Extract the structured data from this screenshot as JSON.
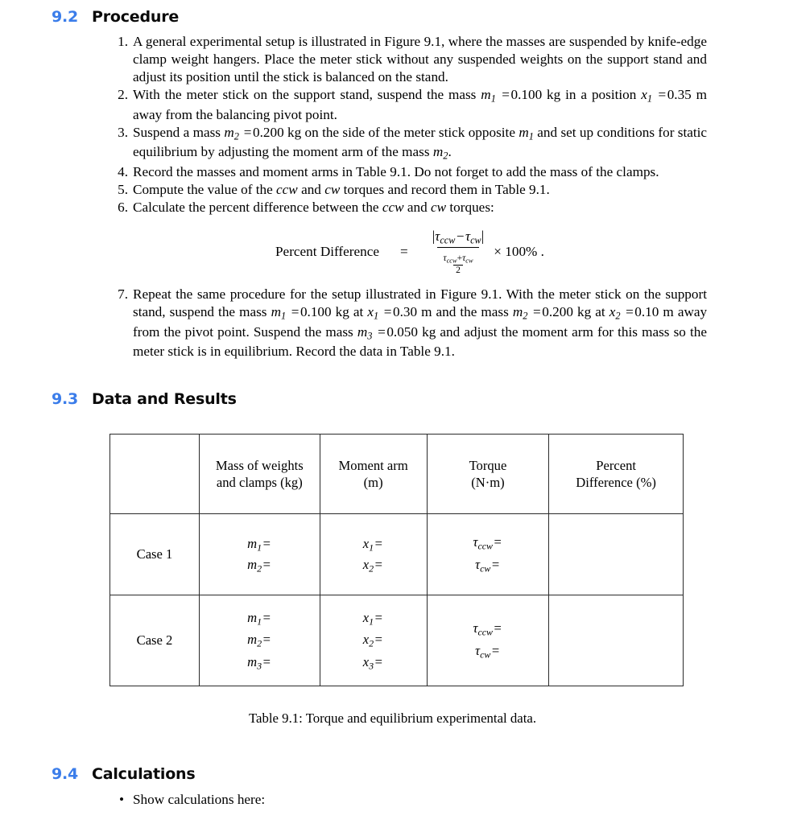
{
  "sections": {
    "procedure": {
      "num": "9.2",
      "title": "Procedure"
    },
    "data_results": {
      "num": "9.3",
      "title": "Data and Results"
    },
    "calculations": {
      "num": "9.4",
      "title": "Calculations"
    }
  },
  "procedure_steps": {
    "s1_marker": "1.",
    "s1_text": "A general experimental setup is illustrated in Figure 9.1, where the masses are suspended by knife-edge clamp weight hangers. Place the meter stick without any suspended weights on the support stand and adjust its position until the stick is balanced on the stand.",
    "s2_marker": "2.",
    "s2_a": "With the meter stick on the support stand, suspend the mass",
    "s2_m1": "m",
    "s2_m1_sub": "1",
    "s2_eq1": "=",
    "s2_val1": "0.100 kg in a position",
    "s2_x1": "x",
    "s2_x1_sub": "1",
    "s2_eq2": "=",
    "s2_val2": "0.35 m away from the balancing pivot point.",
    "s3_marker": "3.",
    "s3_a": "Suspend a mass",
    "s3_m2": "m",
    "s3_m2_sub": "2",
    "s3_eq1": "=",
    "s3_b": "0.200 kg on the side of the meter stick opposite",
    "s3_m1": "m",
    "s3_m1_sub": "1",
    "s3_c": "and set up conditions for static equilibrium by adjusting the moment arm of the mass",
    "s3_m2b": "m",
    "s3_m2b_sub": "2",
    "s3_period": ".",
    "s4_marker": "4.",
    "s4_text": "Record the masses and moment arms in Table 9.1. Do not forget to add the mass of the clamps.",
    "s5_marker": "5.",
    "s5_a": "Compute the value of the",
    "s5_ccw": "ccw",
    "s5_b": "and",
    "s5_cw": "cw",
    "s5_c": "torques and record them in Table 9.1.",
    "s6_marker": "6.",
    "s6_a": "Calculate the percent difference between the",
    "s6_ccw": "ccw",
    "s6_b": "and",
    "s6_cw": "cw",
    "s6_c": "torques:",
    "s7_marker": "7.",
    "s7_a": "Repeat the same procedure for the setup illustrated in Figure 9.1. With the meter stick on the support stand, suspend the mass",
    "s7_m1": "m",
    "s7_m1_sub": "1",
    "s7_eq1": "=",
    "s7_v1": "0.100 kg at",
    "s7_x1": "x",
    "s7_x1_sub": "1",
    "s7_eq2": "=",
    "s7_v2": "0.30 m and the mass",
    "s7_m2": "m",
    "s7_m2_sub": "2",
    "s7_eq3": "=",
    "s7_v3": "0.200 kg at",
    "s7_x2": "x",
    "s7_x2_sub": "2",
    "s7_eq4": "=",
    "s7_v4": "0.10 m away from the pivot point. Suspend the mass",
    "s7_m3": "m",
    "s7_m3_sub": "3",
    "s7_eq5": "=",
    "s7_v5": "0.050 kg and adjust the moment arm for this mass so the meter stick is in equilibrium. Record the data in Table 9.1."
  },
  "formula": {
    "lhs": "Percent Difference",
    "equals": "=",
    "num_open": "|",
    "num_tau1": "τ",
    "num_tau1_sub": "ccw",
    "num_minus": "−",
    "num_tau2": "τ",
    "num_tau2_sub": "cw",
    "num_close": "|",
    "den_tau1": "τ",
    "den_tau1_sub": "ccw",
    "den_plus": "+",
    "den_tau2": "τ",
    "den_tau2_sub": "cw",
    "den_two": "2",
    "tail": "× 100% ."
  },
  "table": {
    "headers": {
      "case_col": "",
      "mass_l1": "Mass of weights",
      "mass_l2": "and clamps (kg)",
      "arm_l1": "Moment arm",
      "arm_l2": "(m)",
      "torque_l1": "Torque",
      "torque_l2": "(N·m)",
      "pct_l1": "Percent",
      "pct_l2": "Difference (%)"
    },
    "case1": {
      "label": "Case 1",
      "mass": [
        {
          "sym": "m",
          "sub": "1",
          "eq": "="
        },
        {
          "sym": "m",
          "sub": "2",
          "eq": "="
        }
      ],
      "arm": [
        {
          "sym": "x",
          "sub": "1",
          "eq": "="
        },
        {
          "sym": "x",
          "sub": "2",
          "eq": "="
        }
      ],
      "torque": [
        {
          "sym": "τ",
          "sub": "ccw",
          "eq": "="
        },
        {
          "sym": "τ",
          "sub": "cw",
          "eq": "="
        }
      ],
      "percent": ""
    },
    "case2": {
      "label": "Case 2",
      "mass": [
        {
          "sym": "m",
          "sub": "1",
          "eq": "="
        },
        {
          "sym": "m",
          "sub": "2",
          "eq": "="
        },
        {
          "sym": "m",
          "sub": "3",
          "eq": "="
        }
      ],
      "arm": [
        {
          "sym": "x",
          "sub": "1",
          "eq": "="
        },
        {
          "sym": "x",
          "sub": "2",
          "eq": "="
        },
        {
          "sym": "x",
          "sub": "3",
          "eq": "="
        }
      ],
      "torque": [
        {
          "sym": "τ",
          "sub": "ccw",
          "eq": "="
        },
        {
          "sym": "τ",
          "sub": "cw",
          "eq": "="
        }
      ],
      "percent": ""
    },
    "caption": "Table 9.1: Torque and equilibrium experimental data."
  },
  "calculations": {
    "bullet_marker": "•",
    "bullet_text": "Show calculations here:"
  },
  "colors": {
    "section_number": "#3b7dea",
    "text": "#000000",
    "table_border": "#2a2a2a"
  }
}
